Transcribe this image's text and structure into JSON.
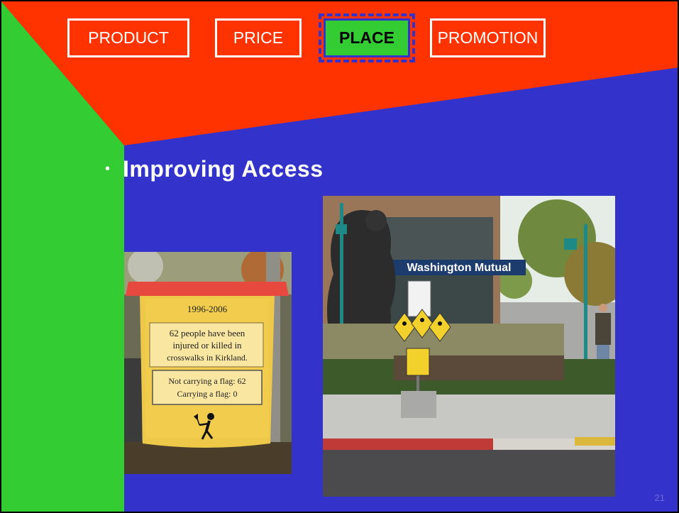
{
  "colors": {
    "background_blue": "#3333cc",
    "header_red": "#ff3300",
    "side_green": "#33cc33",
    "tab_border": "#ffffff",
    "active_tab_fill": "#33cc33"
  },
  "tabs": [
    {
      "label": "PRODUCT",
      "active": false
    },
    {
      "label": "PRICE",
      "active": false
    },
    {
      "label": "PLACE",
      "active": true
    },
    {
      "label": "PROMOTION",
      "active": false
    }
  ],
  "content": {
    "bullet_symbol": "•",
    "heading": "Improving Access"
  },
  "sign_photo": {
    "years": "1996-2006",
    "message_lines": [
      "62 people have been",
      "injured or killed in",
      "crosswalks in Kirkland."
    ],
    "stats_lines": [
      "Not carrying a flag: 62",
      "Carrying a flag: 0"
    ],
    "icon": "pedestrian-with-flag-icon"
  },
  "street_photo": {
    "bank_sign": "Washington Mutual",
    "icon": "pedestrian-crossing-sign-icon"
  },
  "footer": {
    "slide_number": "21"
  }
}
